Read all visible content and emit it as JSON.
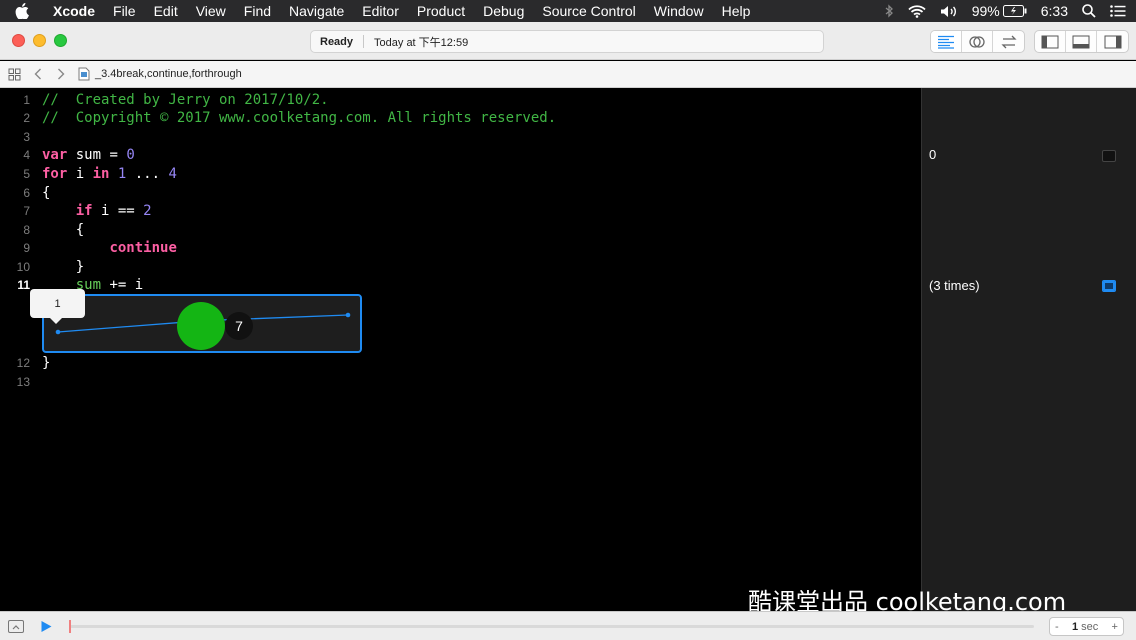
{
  "menubar": {
    "items": [
      "Xcode",
      "File",
      "Edit",
      "View",
      "Find",
      "Navigate",
      "Editor",
      "Product",
      "Debug",
      "Source Control",
      "Window",
      "Help"
    ],
    "battery": "99%",
    "time": "6:33"
  },
  "toolbar": {
    "status": "Ready",
    "timestamp": "Today at 下午12:59"
  },
  "jumpbar": {
    "file": "_3.4break,continue,forthrough"
  },
  "editor": {
    "lines": [
      {
        "n": "1",
        "text": "//  Created by Jerry on 2017/10/2."
      },
      {
        "n": "2",
        "text": "//  Copyright © 2017 www.coolketang.com. All rights reserved."
      },
      {
        "n": "3",
        "text": ""
      },
      {
        "n": "4",
        "kw": "var",
        "rest": " sum = ",
        "num": "0"
      },
      {
        "n": "5",
        "kw": "for",
        "mid": " i ",
        "kw2": "in",
        "sp": " ",
        "num1": "1",
        "dots": " ... ",
        "num2": "4"
      },
      {
        "n": "6",
        "text": "{"
      },
      {
        "n": "7",
        "indent": "    ",
        "kw": "if",
        "rest": " i == ",
        "num": "2"
      },
      {
        "n": "8",
        "text": "    {"
      },
      {
        "n": "9",
        "indent": "        ",
        "kw": "continue"
      },
      {
        "n": "10",
        "text": "    }"
      },
      {
        "n": "11",
        "indent": "    ",
        "var": "sum",
        "rest": " += i"
      },
      {
        "n": "12",
        "text": "}"
      },
      {
        "n": "13",
        "text": ""
      }
    ],
    "tooltip_value": "1",
    "click_badge": "7",
    "graph_points": [
      1,
      3,
      4
    ]
  },
  "results": {
    "line4": "0",
    "line11": "(3 times)"
  },
  "watermark": "酷课堂出品 coolketang.com",
  "bottombar": {
    "step_minus": "-",
    "step_value": "1",
    "step_unit": "sec",
    "step_plus": "+"
  },
  "colors": {
    "comment": "#41b645",
    "keyword": "#fc5fa3",
    "number": "#9686f5",
    "accent": "#1f8bf2",
    "click": "#14b514"
  }
}
